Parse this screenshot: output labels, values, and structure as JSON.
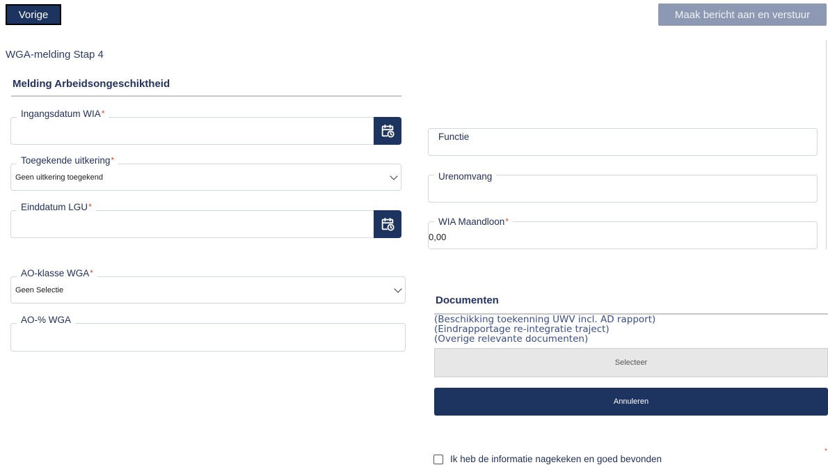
{
  "header": {
    "prev_label": "Vorige",
    "send_label": "Maak bericht aan en verstuur"
  },
  "step_title": "WGA-melding Stap 4",
  "section_title": "Melding Arbeidsongeschiktheid",
  "fields": {
    "ingangsdatum": {
      "label": "Ingangsdatum WIA",
      "required": "*",
      "value": ""
    },
    "uitkering": {
      "label": "Toegekende uitkering",
      "required": "*",
      "value": "Geen uitkering toegekend"
    },
    "einddatum": {
      "label": "Einddatum LGU",
      "required": "*",
      "value": ""
    },
    "aoklasse": {
      "label": "AO-klasse WGA",
      "required": "*",
      "value": "Geen Selectie"
    },
    "aoperc": {
      "label": "AO-% WGA",
      "value": ""
    },
    "functie": {
      "label": "Functie",
      "value": ""
    },
    "urenomvang": {
      "label": "Urenomvang",
      "value": ""
    },
    "maandloon": {
      "label": "WIA Maandloon",
      "required": "*",
      "value": "0,00"
    }
  },
  "documents": {
    "title": "Documenten",
    "items": [
      "(Beschikking toekenning UWV incl. AD rapport)",
      "(Eindrapportage re-integratie traject)",
      "(Overige relevante documenten)"
    ],
    "select_label": "Selecteer",
    "cancel_label": "Annuleren"
  },
  "confirm": {
    "label": "Ik heb de informatie nagekeken en goed bevonden",
    "required": "*"
  },
  "icons": {
    "calendar": "calendar-clock-icon",
    "chevron": "chevron-down-icon"
  },
  "colors": {
    "primary": "#1d3461",
    "disabled": "#8d98b2",
    "required": "#e0452b"
  }
}
